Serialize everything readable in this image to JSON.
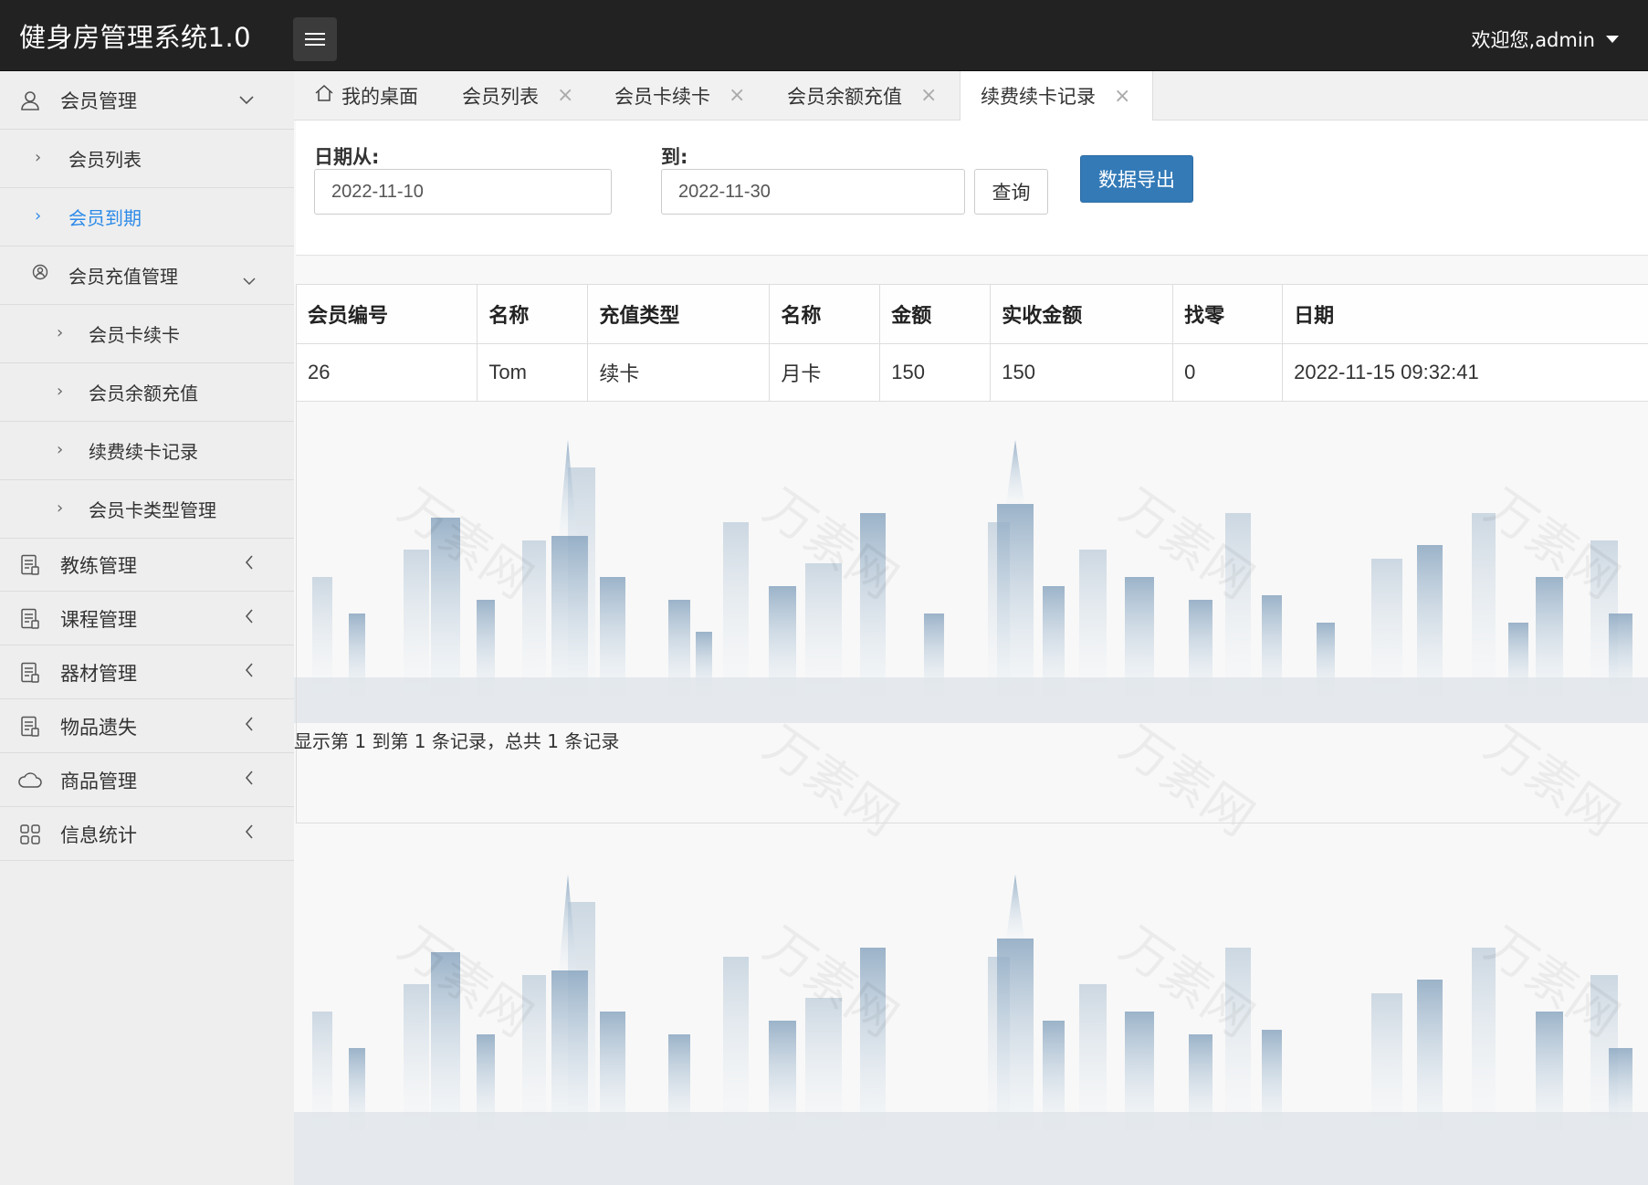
{
  "header": {
    "brand": "健身房管理系统1.0",
    "user_greeting": "欢迎您,admin"
  },
  "sidebar": {
    "groups": [
      {
        "label": "会员管理",
        "icon": "user-icon",
        "expanded": true
      },
      {
        "label": "教练管理",
        "icon": "document-icon",
        "expanded": false
      },
      {
        "label": "课程管理",
        "icon": "document-icon",
        "expanded": false
      },
      {
        "label": "器材管理",
        "icon": "document-icon",
        "expanded": false
      },
      {
        "label": "物品遗失",
        "icon": "document-icon",
        "expanded": false
      },
      {
        "label": "商品管理",
        "icon": "cloud-icon",
        "expanded": false
      },
      {
        "label": "信息统计",
        "icon": "grid-icon",
        "expanded": false
      }
    ],
    "member_items": [
      "会员列表",
      "会员到期"
    ],
    "recharge_group": {
      "label": "会员充值管理",
      "icon": "recharge-icon"
    },
    "recharge_items": [
      "会员卡续卡",
      "会员余额充值",
      "续费续卡记录",
      "会员卡类型管理"
    ]
  },
  "tabs": [
    {
      "label": "我的桌面",
      "closable": false,
      "active": false
    },
    {
      "label": "会员列表",
      "closable": true,
      "active": false
    },
    {
      "label": "会员卡续卡",
      "closable": true,
      "active": false
    },
    {
      "label": "会员余额充值",
      "closable": true,
      "active": false
    },
    {
      "label": "续费续卡记录",
      "closable": true,
      "active": true
    }
  ],
  "filter": {
    "from_label": "日期从:",
    "from_value": "2022-11-10",
    "to_label": "到:",
    "to_value": "2022-11-30",
    "query_label": "查询",
    "export_label": "数据导出"
  },
  "table": {
    "headers": [
      "会员编号",
      "名称",
      "充值类型",
      "名称",
      "金额",
      "实收金额",
      "找零",
      "日期"
    ],
    "rows": [
      [
        "26",
        "Tom",
        "续卡",
        "月卡",
        "150",
        "150",
        "0",
        "2022-11-15 09:32:41"
      ]
    ]
  },
  "pager": {
    "info": "显示第 1 到第 1 条记录，总共 1 条记录"
  },
  "watermark_text": "万素网",
  "colors": {
    "header_bg": "#222222",
    "accent": "#2d8be8",
    "export_button": "#337ab7"
  }
}
